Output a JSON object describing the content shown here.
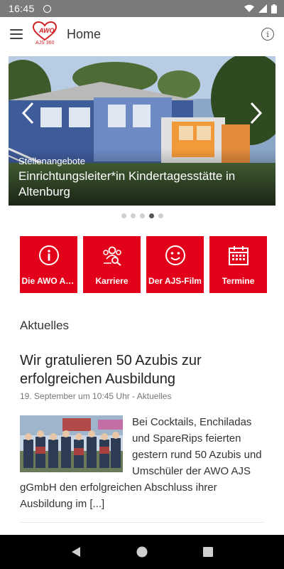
{
  "status_bar": {
    "time": "16:45",
    "icons": [
      "sync-circle-icon",
      "wifi-icon",
      "signal-icon",
      "battery-icon"
    ]
  },
  "app_bar": {
    "menu_icon": "hamburger-icon",
    "logo_text": "AWO",
    "logo_subtext": "AJS 360",
    "title": "Home",
    "info_icon": "info-icon",
    "info_glyph": "i"
  },
  "carousel": {
    "category": "Stellenangebote",
    "title": "Einrichtungsleiter*in Kindertagesstätte in Altenburg",
    "prev_icon": "chevron-left-icon",
    "next_icon": "chevron-right-icon",
    "slide_count": 5,
    "active_slide": 4
  },
  "tiles": [
    {
      "label": "Die AWO AJ...",
      "icon": "info-circle-icon"
    },
    {
      "label": "Karriere",
      "icon": "people-search-icon"
    },
    {
      "label": "Der AJS-Film",
      "icon": "smiley-icon"
    },
    {
      "label": "Termine",
      "icon": "calendar-icon"
    }
  ],
  "news": {
    "section_title": "Aktuelles",
    "article": {
      "title": "Wir gratulieren 50 Azubis zur erfolgreichen Ausbildung",
      "meta": "19. September um 10:45 Uhr - Aktuelles",
      "excerpt": "Bei Cocktails, Enchiladas und SpareRips feierten gestern rund 50 Azubis und Umschüler der AWO AJS gGmbH den erfolgreichen Abschluss ihrer Ausbildung im [...]"
    }
  },
  "nav_bar": {
    "back_icon": "back-triangle-icon",
    "home_icon": "home-circle-icon",
    "recents_icon": "recents-square-icon"
  },
  "colors": {
    "brand_red": "#e2001a",
    "status_bar": "#7a7a7a",
    "nav_bar": "#000000"
  }
}
